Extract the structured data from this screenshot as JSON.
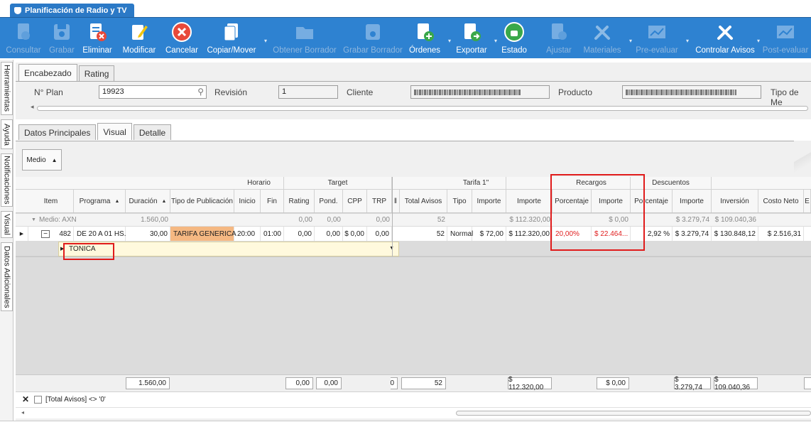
{
  "window_tab": "Planificación de Radio y TV",
  "toolbar": [
    {
      "label": "Consultar",
      "icon": "search-doc-icon",
      "enabled": false
    },
    {
      "label": "Grabar",
      "icon": "save-icon",
      "enabled": false
    },
    {
      "label": "Eliminar",
      "icon": "delete-doc-icon",
      "enabled": true
    },
    {
      "label": "Modificar",
      "icon": "edit-icon",
      "enabled": true
    },
    {
      "label": "Cancelar",
      "icon": "cancel-icon",
      "enabled": true
    },
    {
      "label": "Copiar/Mover",
      "icon": "copy-icon",
      "enabled": true
    },
    {
      "label": "Obtener Borrador",
      "icon": "folder-icon",
      "enabled": false
    },
    {
      "label": "Grabar Borrador",
      "icon": "save-draft-icon",
      "enabled": false
    },
    {
      "label": "Órdenes",
      "icon": "add-doc-icon",
      "enabled": true
    },
    {
      "label": "Exportar",
      "icon": "export-icon",
      "enabled": true
    },
    {
      "label": "Estado",
      "icon": "thumbs-up-icon",
      "enabled": true
    },
    {
      "label": "Ajustar",
      "icon": "adjust-icon",
      "enabled": false
    },
    {
      "label": "Materiales",
      "icon": "tools-icon",
      "enabled": false
    },
    {
      "label": "Pre-evaluar",
      "icon": "chart-icon",
      "enabled": false
    },
    {
      "label": "Controlar Avisos",
      "icon": "tools-icon",
      "enabled": true
    },
    {
      "label": "Post-evaluar",
      "icon": "chart-icon",
      "enabled": false
    }
  ],
  "sidebar_tabs": [
    "Herramientas",
    "Ayuda",
    "Notificaciones",
    "Visual",
    "Datos Adicionales"
  ],
  "header_tabs": [
    "Encabezado",
    "Rating"
  ],
  "header_fields": {
    "plan_label": "N° Plan",
    "plan_value": "19923",
    "revision_label": "Revisión",
    "revision_value": "1",
    "cliente_label": "Cliente",
    "producto_label": "Producto",
    "tipo_label": "Tipo de Me"
  },
  "main_tabs": [
    "Datos Principales",
    "Visual",
    "Detalle"
  ],
  "medio_button": "Medio",
  "band_headers": {
    "horario": "Horario",
    "target": "Target",
    "tarifa": "Tarifa 1\"",
    "recargos": "Recargos",
    "descuentos": "Descuentos"
  },
  "columns": [
    "Item",
    "Programa",
    "Duración",
    "Tipo de Publicación",
    "Inicio",
    "Fin",
    "Rating",
    "Pond.",
    "CPP",
    "TRP",
    "Total Avisos",
    "Tipo",
    "Importe",
    "Importe",
    "Porcentaje",
    "Importe",
    "Porcentaje",
    "Importe",
    "Inversión",
    "Costo Neto",
    "E"
  ],
  "group_row": {
    "label": "Medio: AXN",
    "duracion": "1.560,00",
    "rating": "0,00",
    "pond": "0,00",
    "trp": "0,00",
    "total_avisos": "52",
    "importe": "$ 112.320,00",
    "rec_importe": "$ 0,00",
    "desc_importe": "$ 3.279,74",
    "inversion": "$ 109.040,36"
  },
  "data_row": {
    "item": "482",
    "programa": "DE 20 A 01 HS.",
    "duracion": "30,00",
    "tipo_pub": "TARIFA GENERICA",
    "inicio": "20:00",
    "fin": "01:00",
    "rating": "0,00",
    "pond": "0,00",
    "cpp": "$ 0,00",
    "trp": "0,00",
    "total_avisos": "52",
    "tipo": "Normal",
    "tarifa_importe": "$ 72,00",
    "importe": "$ 112.320,00",
    "rec_pct": "20,00%",
    "rec_importe": "$ 22.464...",
    "desc_pct": "2,92 %",
    "desc_importe": "$ 3.279,74",
    "inversion": "$ 130.848,12",
    "costo_neto": "$ 2.516,31"
  },
  "detail_row": {
    "value": "TONICA"
  },
  "footer": {
    "duracion": "1.560,00",
    "rating": "0,00",
    "pond": "0,00",
    "trp": "0",
    "total_avisos": "52",
    "importe": "$ 112.320,00",
    "rec_importe": "$ 0,00",
    "desc_importe": "$ 3.279,74",
    "inversion": "$ 109.040,36"
  },
  "filter_text": "[Total Avisos] <> '0'",
  "colors": {
    "ribbon": "#2e82d1",
    "highlight_red": "#e01b1b",
    "tarifa_cell": "#f5b882",
    "detail_row": "#fff9dd"
  }
}
